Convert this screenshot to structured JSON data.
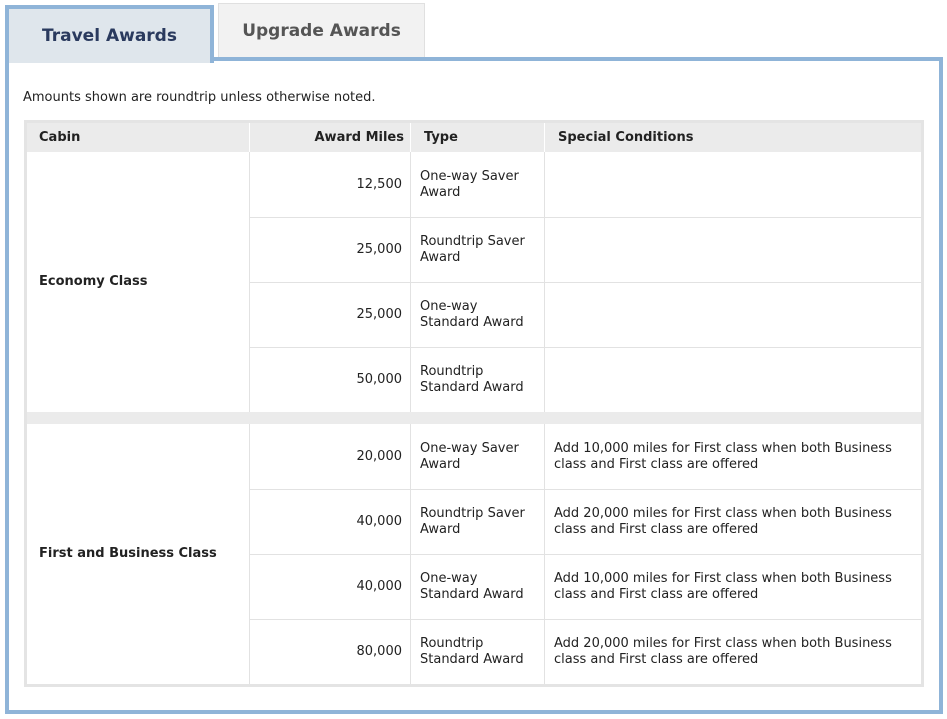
{
  "tabs": [
    {
      "label": "Travel Awards",
      "active": true
    },
    {
      "label": "Upgrade Awards",
      "active": false
    }
  ],
  "note": "Amounts shown are roundtrip unless otherwise noted.",
  "table": {
    "headers": [
      "Cabin",
      "Award Miles",
      "Type",
      "Special Conditions"
    ],
    "groups": [
      {
        "cabin": "Economy Class",
        "rows": [
          {
            "miles": "12,500",
            "type": "One-way Saver Award",
            "conditions": ""
          },
          {
            "miles": "25,000",
            "type": "Roundtrip Saver Award",
            "conditions": ""
          },
          {
            "miles": "25,000",
            "type": "One-way Standard Award",
            "conditions": ""
          },
          {
            "miles": "50,000",
            "type": "Roundtrip Standard Award",
            "conditions": ""
          }
        ]
      },
      {
        "cabin": "First and Business Class",
        "rows": [
          {
            "miles": "20,000",
            "type": "One-way Saver Award",
            "conditions": "Add 10,000 miles for First class when both Business class and First class are offered"
          },
          {
            "miles": "40,000",
            "type": "Roundtrip Saver Award",
            "conditions": "Add 20,000 miles for First class when both Business class and First class are offered"
          },
          {
            "miles": "40,000",
            "type": "One-way Standard Award",
            "conditions": "Add 10,000 miles for First class when both Business class and First class are offered"
          },
          {
            "miles": "80,000",
            "type": "Roundtrip Standard Award",
            "conditions": "Add 20,000 miles for First class when both Business class and First class are offered"
          }
        ]
      }
    ]
  },
  "colors": {
    "tab_border": "#8fb4d8",
    "tab_active_bg": "#dfe6ec",
    "tab_active_text": "#2a3a5e",
    "header_bg": "#ebebeb"
  }
}
